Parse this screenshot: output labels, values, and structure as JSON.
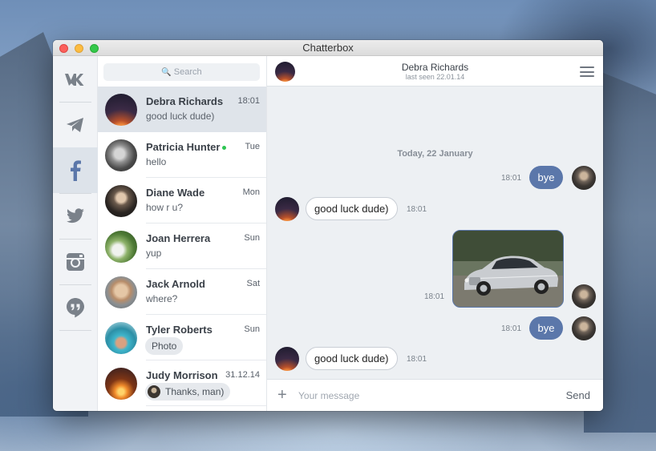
{
  "window": {
    "title": "Chatterbox"
  },
  "services": [
    {
      "name": "vk-icon",
      "label": "VK",
      "active": false
    },
    {
      "name": "telegram-icon",
      "label": "Telegram",
      "active": false
    },
    {
      "name": "facebook-icon",
      "label": "f",
      "active": true
    },
    {
      "name": "twitter-icon",
      "label": "Twitter",
      "active": false
    },
    {
      "name": "instagram-icon",
      "label": "Instagram",
      "active": false
    },
    {
      "name": "hangouts-icon",
      "label": "Hangouts",
      "active": false
    }
  ],
  "search": {
    "placeholder": "Search"
  },
  "conversations": [
    {
      "name": "Debra Richards",
      "time": "18:01",
      "preview": "good luck dude)",
      "active": true
    },
    {
      "name": "Patricia Hunter",
      "time": "Tue",
      "preview": "hello",
      "online": true
    },
    {
      "name": "Diane Wade",
      "time": "Mon",
      "preview": "how r u?"
    },
    {
      "name": "Joan Herrera",
      "time": "Sun",
      "preview": "yup"
    },
    {
      "name": "Jack Arnold",
      "time": "Sat",
      "preview": "where?"
    },
    {
      "name": "Tyler Roberts",
      "time": "Sun",
      "preview": "Photo"
    },
    {
      "name": "Judy Morrison",
      "time": "31.12.14",
      "preview": "Thanks, man)"
    }
  ],
  "chat": {
    "contact_name": "Debra Richards",
    "contact_status": "last seen 22.01.14",
    "day_separator": "Today, 22 January",
    "messages": [
      {
        "direction": "out",
        "text": "bye",
        "time": "18:01"
      },
      {
        "direction": "in",
        "text": "good luck dude)",
        "time": "18:01"
      },
      {
        "direction": "out",
        "type": "photo",
        "time": "18:01"
      },
      {
        "direction": "out",
        "text": "bye",
        "time": "18:01"
      },
      {
        "direction": "in",
        "text": "good luck dude)",
        "time": "18:01"
      }
    ],
    "composer": {
      "placeholder": "Your message",
      "send_label": "Send",
      "attach_label": "+"
    }
  },
  "colors": {
    "accent": "#5b77aa",
    "online": "#2ec553",
    "active_row": "#dfe4ea"
  }
}
